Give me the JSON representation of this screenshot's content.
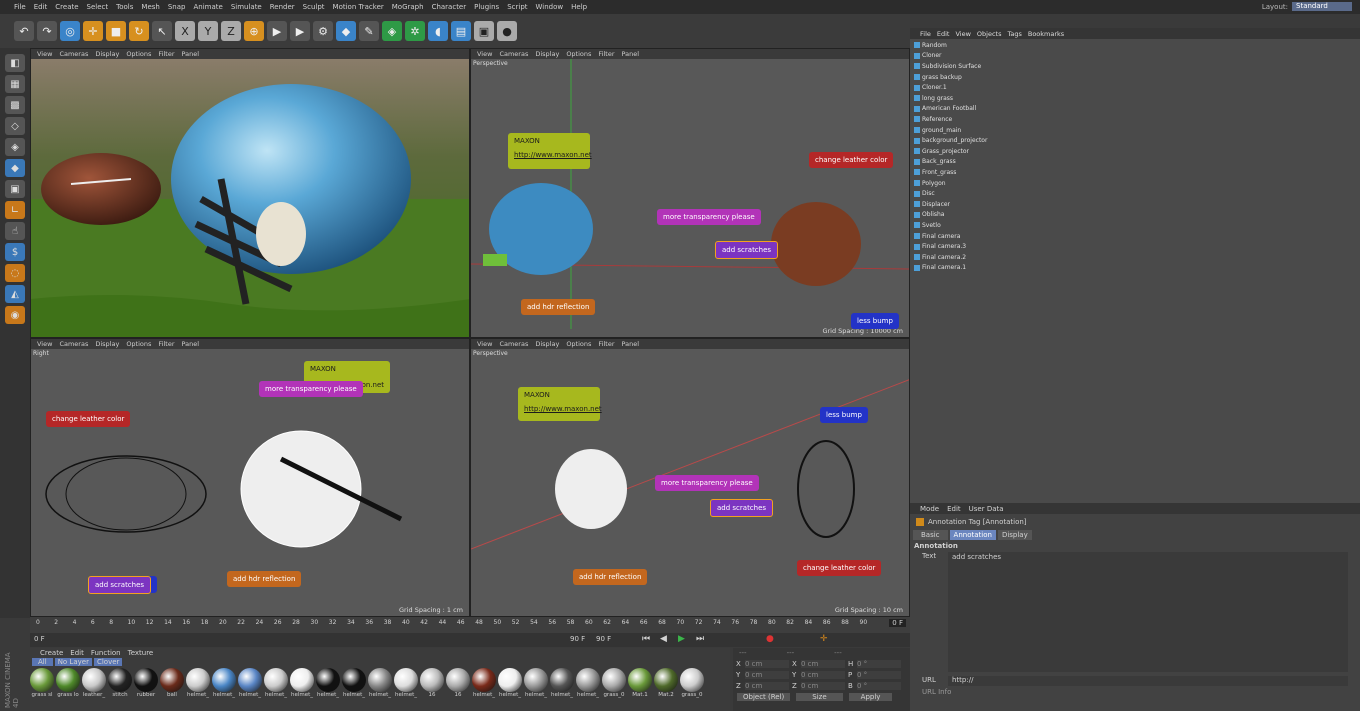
{
  "menu": [
    "File",
    "Edit",
    "Create",
    "Select",
    "Tools",
    "Mesh",
    "Snap",
    "Animate",
    "Simulate",
    "Render",
    "Sculpt",
    "Motion Tracker",
    "MoGraph",
    "Character",
    "Plugins",
    "Script",
    "Window",
    "Help"
  ],
  "layout": {
    "label": "Layout:",
    "value": "Standard"
  },
  "viewport_menu": [
    "View",
    "Cameras",
    "Display",
    "Options",
    "Filter",
    "Panel"
  ],
  "viewports": {
    "tr": {
      "name": "Perspective",
      "grid": "Grid Spacing : 10000 cm"
    },
    "bl": {
      "name": "Right",
      "grid": "Grid Spacing : 1 cm"
    },
    "br": {
      "name": "Perspective",
      "grid": "Grid Spacing : 10 cm"
    }
  },
  "annotations": {
    "maxon": "MAXON",
    "url": "http://www.maxon.net",
    "leather": "change leather color",
    "transparency": "more transparency please",
    "scratches": "add scratches",
    "hdr": "add hdr reflection",
    "bump": "less bump",
    "maxon_url_partial": "maxon.net"
  },
  "object_menu": [
    "File",
    "Edit",
    "View",
    "Objects",
    "Tags",
    "Bookmarks"
  ],
  "objects": [
    "Random",
    "Cloner",
    "Subdivision Surface",
    "grass backup",
    "Cloner.1",
    "long grass",
    "American Football",
    "Reference",
    "ground_main",
    "background_projector",
    "Grass_projector",
    "Back_grass",
    "Front_grass",
    "Polygon",
    "Disc",
    "Displacer",
    "Oblisha",
    "Svetlo",
    "Final camera",
    "Final camera.3",
    "Final camera.2",
    "Final camera.1"
  ],
  "attributes": {
    "menu": [
      "Mode",
      "Edit",
      "User Data"
    ],
    "title": "Annotation Tag [Annotation]",
    "tabs": [
      "Basic",
      "Annotation",
      "Display"
    ],
    "section": "Annotation",
    "text_label": "Text",
    "text_value": "add scratches",
    "url_label": "URL",
    "url_value": "http://",
    "url_info": "URL Info"
  },
  "timeline": {
    "ticks": [
      "0",
      "2",
      "4",
      "6",
      "8",
      "10",
      "12",
      "14",
      "16",
      "18",
      "20",
      "22",
      "24",
      "26",
      "28",
      "30",
      "32",
      "34",
      "36",
      "38",
      "40",
      "42",
      "44",
      "46",
      "48",
      "50",
      "52",
      "54",
      "56",
      "58",
      "60",
      "62",
      "64",
      "66",
      "68",
      "70",
      "72",
      "74",
      "76",
      "78",
      "80",
      "82",
      "84",
      "86",
      "88",
      "90"
    ],
    "frame": "0 F",
    "start": "0 F",
    "end": "90 F",
    "end2": "90 F"
  },
  "materials": {
    "menu": [
      "Create",
      "Edit",
      "Function",
      "Texture"
    ],
    "filters": [
      "All",
      "No Layer",
      "Clover"
    ],
    "items": [
      "grass sl",
      "grass lo",
      "leather_",
      "stitch",
      "rubber",
      "ball",
      "helmet_",
      "helmet_",
      "helmet_",
      "helmet_",
      "helmet_",
      "helmet_",
      "helmet_",
      "helmet_",
      "helmet_",
      "16",
      "16",
      "helmet_",
      "helmet_",
      "helmet_",
      "helmet_",
      "helmet_",
      "grass_0",
      "Mat.1",
      "Mat.2",
      "grass_0"
    ]
  },
  "coords": {
    "headers": [
      "---",
      "---",
      "---"
    ],
    "rows": [
      [
        "X",
        "0 cm",
        "X",
        "0 cm",
        "H",
        "0 °"
      ],
      [
        "Y",
        "0 cm",
        "Y",
        "0 cm",
        "P",
        "0 °"
      ],
      [
        "Z",
        "0 cm",
        "Z",
        "0 cm",
        "B",
        "0 °"
      ]
    ],
    "mode": "Object (Rel)",
    "size": "Size",
    "apply": "Apply"
  },
  "brand": "MAXON CINEMA 4D"
}
